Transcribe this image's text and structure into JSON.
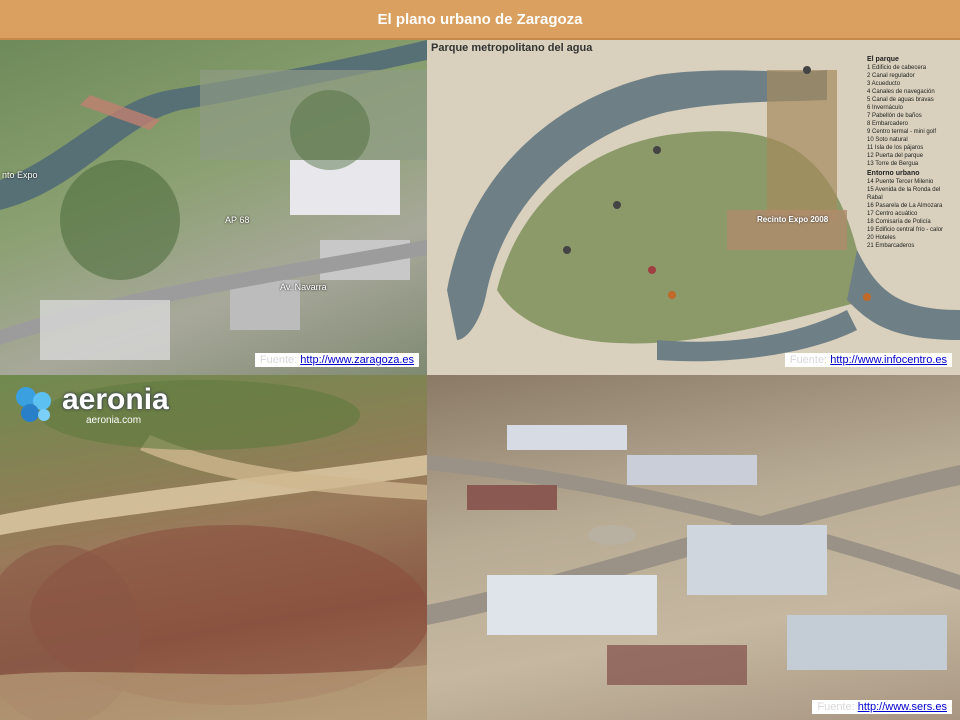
{
  "title": "El plano urbano de Zaragoza",
  "panels": {
    "top_left": {
      "source_label": "Fuente:",
      "source_link": "http://www.zaragoza.es",
      "labels": [
        "nto Expo",
        "AP 68",
        "Av. Navarra"
      ]
    },
    "top_right": {
      "map_title": "Parque metropolitano del agua",
      "source_label": "Fuente:",
      "source_link": "http://www.infocentro.es",
      "recinto_label": "Recinto Expo 2008",
      "legend": {
        "section1_title": "El parque",
        "section1_items": [
          "1 Edificio de cabecera",
          "2 Canal regulador",
          "3 Acueducto",
          "4 Canales de navegación",
          "5 Canal de aguas bravas",
          "6 Invernáculo",
          "7 Pabellón de baños",
          "8 Embarcadero",
          "9 Centro termal - mini golf",
          "10 Soto natural",
          "11 Isla de los pájaros",
          "12 Puerta del parque",
          "13 Torre de Bergua"
        ],
        "section2_title": "Entorno urbano",
        "section2_items": [
          "14 Puente Tercer Milenio",
          "15 Avenida de la Ronda del Rabal",
          "16 Pasarela de La Almozara",
          "17 Centro acuático",
          "18 Comisaría de Policía",
          "19 Edificio central frío - calor",
          "20 Hoteles",
          "21 Embarcaderos"
        ]
      }
    },
    "bottom_left": {
      "logo_name": "aeronia",
      "logo_url": "aeronia.com"
    },
    "bottom_right": {
      "source_label": "Fuente:",
      "source_link": "http://www.sers.es"
    }
  }
}
